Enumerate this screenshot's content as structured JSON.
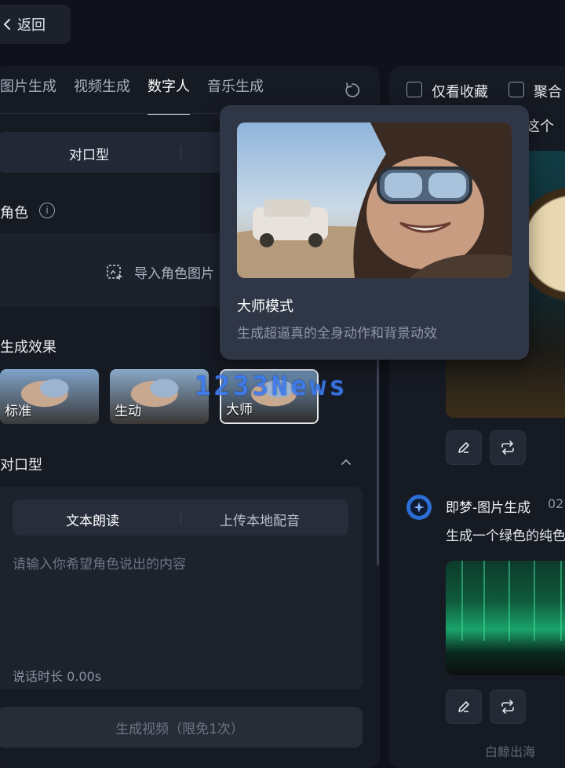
{
  "header": {
    "back_label": "返回"
  },
  "left": {
    "tabs": [
      {
        "label": "图片生成",
        "active": false
      },
      {
        "label": "视频生成",
        "active": false
      },
      {
        "label": "数字人",
        "active": true
      },
      {
        "label": "音乐生成",
        "active": false
      }
    ],
    "mode_segment": {
      "selected": "对口型"
    },
    "role": {
      "label": "角色",
      "import_label": "导入角色图片"
    },
    "effect": {
      "label": "生成效果",
      "options": [
        {
          "label": "标准",
          "selected": false
        },
        {
          "label": "生动",
          "selected": false
        },
        {
          "label": "大师",
          "selected": true
        }
      ]
    },
    "lip_sync": {
      "label": "对口型",
      "sub_tabs": [
        "文本朗读",
        "上传本地配音"
      ],
      "placeholder": "请输入你希望角色说出的内容",
      "duration_label": "说话时长 0.00s"
    },
    "generate_button": "生成视频（限免1次）"
  },
  "popover": {
    "title": "大师模式",
    "description": "生成超逼真的全身动作和背景动效"
  },
  "right": {
    "filters": [
      "仅看收藏",
      "聚合"
    ],
    "snippet": "，这个",
    "message": {
      "app_name": "即梦-图片生成",
      "time": "02",
      "prompt": "生成一个绿色的纯色"
    }
  },
  "watermarks": {
    "overlay": "1233News",
    "bottom": "白鲸出海"
  },
  "colors": {
    "accent_blue": "#3c7bf0",
    "panel": "#161a23",
    "background": "#0f121a"
  }
}
